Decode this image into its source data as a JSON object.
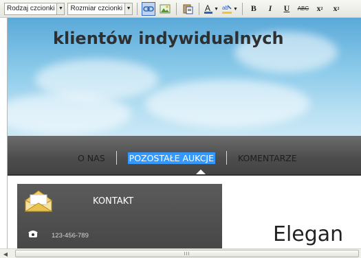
{
  "toolbar": {
    "font_family_label": "Rodzaj czcionki",
    "font_size_label": "Rozmiar czcionki",
    "bold_label": "B",
    "italic_label": "I",
    "underline_label": "U",
    "strike_label": "ABC",
    "subscript_label": "x",
    "superscript_label": "x"
  },
  "banner": {
    "title": "klientów indywidualnych"
  },
  "nav": {
    "items": [
      "O NAS",
      "POZOSTAŁE AUKCJE",
      "KOMENTARZE"
    ],
    "selected": "POZOSTAŁE AUKCJE"
  },
  "contact": {
    "title": "KONTAKT",
    "phone": "123-456-789"
  },
  "heading": {
    "text": "Elegan"
  },
  "scrollbar": {
    "grip": "III"
  },
  "colors": {
    "selection": "#3399ff",
    "nav_bg": "#4c4c4c",
    "sky": "#8ccbea"
  }
}
